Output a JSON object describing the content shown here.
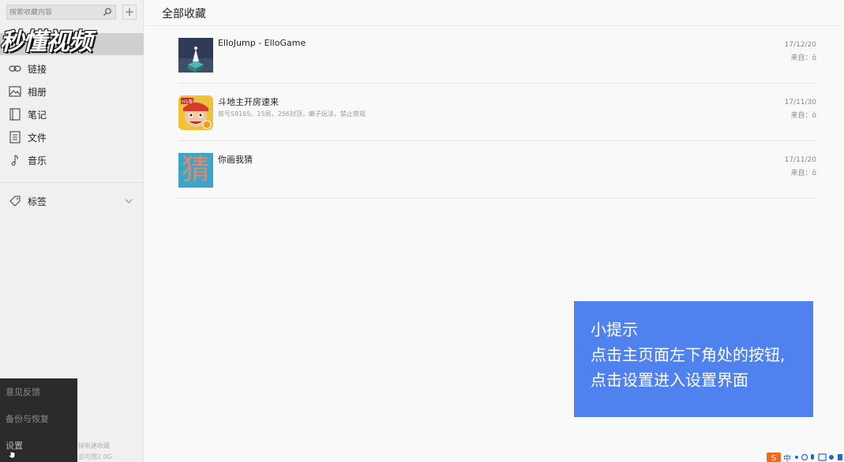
{
  "sidebar": {
    "search_placeholder": "搜索收藏内容",
    "add_label": "+",
    "watermark": "秒懂视频",
    "items": [
      {
        "label": "链接",
        "icon": "link-icon"
      },
      {
        "label": "相册",
        "icon": "image-icon"
      },
      {
        "label": "笔记",
        "icon": "note-icon"
      },
      {
        "label": "文件",
        "icon": "file-icon"
      },
      {
        "label": "音乐",
        "icon": "music-icon"
      }
    ],
    "tags_label": "标签",
    "menu": [
      {
        "label": "意见反馈"
      },
      {
        "label": "备份与恢复"
      },
      {
        "label": "设置"
      }
    ],
    "footer_line1": "接新建收藏",
    "footer_line2": "总可用2.0G"
  },
  "main": {
    "title": "全部收藏",
    "items": [
      {
        "title": "ElloJump - ElloGame",
        "subtitle": "",
        "date": "17/12/20",
        "from": "来自：ô"
      },
      {
        "title": "斗地主开房速来",
        "subtitle": "房号S9165，15局，256封顶，癞子玩法，禁止旁观",
        "date": "17/11/30",
        "from": "来自：ô"
      },
      {
        "title": "你画我猜",
        "subtitle": "",
        "date": "17/11/20",
        "from": "来自：ô"
      }
    ],
    "thumb3_char": "猜",
    "thumb2_badge": "H5版"
  },
  "tip": {
    "line1": "小提示",
    "line2": "点击主页面左下角处的按钮,",
    "line3": "点击设置进入设置界面"
  },
  "tray": {
    "ime_label": "中"
  },
  "colors": {
    "tip_bg": "#4f82ef",
    "menu_bg": "#2b2b2b",
    "sidebar_bg": "#f0f0f0",
    "thumb3_bg": "#3aa7c9",
    "thumb3_char": "#e8866b"
  }
}
